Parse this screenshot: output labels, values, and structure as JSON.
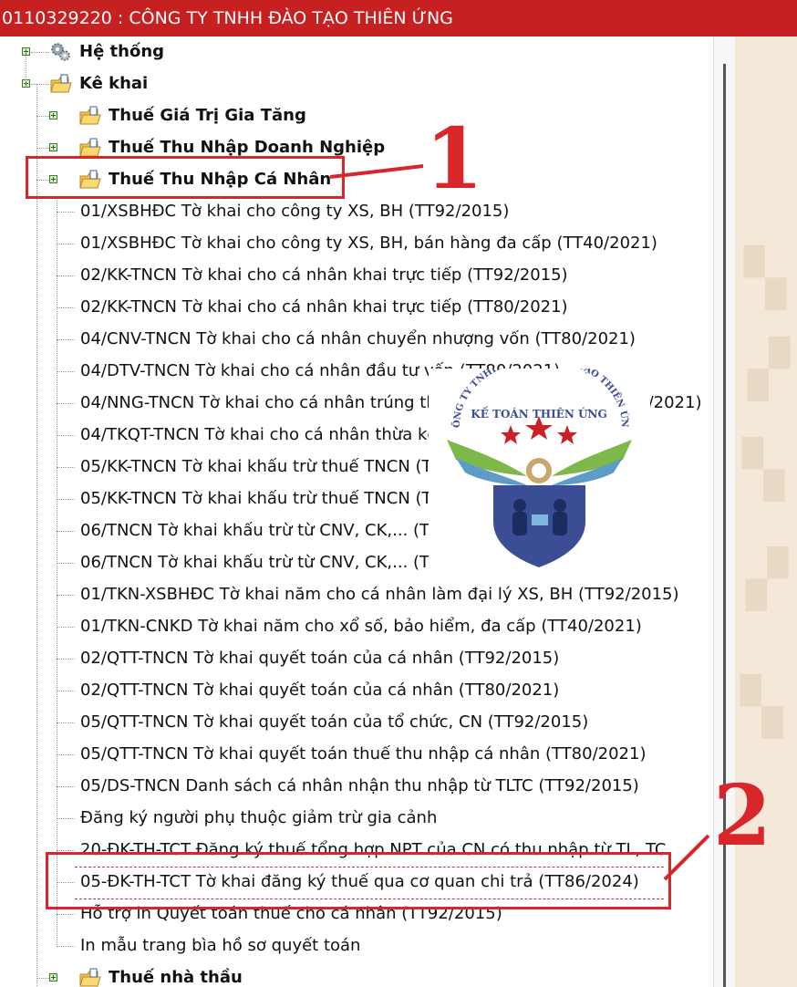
{
  "window": {
    "title": "0110329220 : CÔNG TY TNHH ĐÀO TẠO THIÊN ỨNG"
  },
  "tree": {
    "he_thong": "Hệ thống",
    "ke_khai": "Kê khai",
    "thue_gtgt": "Thuế Giá Trị Gia Tăng",
    "thue_tndn": "Thuế Thu Nhập Doanh Nghiệp",
    "thue_tncn": "Thuế Thu Nhập Cá Nhân",
    "tncn_items": [
      "01/XSBHĐC Tờ khai cho công ty XS, BH (TT92/2015)",
      "01/XSBHĐC Tờ khai cho công ty XS, BH, bán hàng đa cấp (TT40/2021)",
      "02/KK-TNCN Tờ khai cho cá nhân khai trực tiếp (TT92/2015)",
      "02/KK-TNCN Tờ khai cho cá nhân khai trực tiếp (TT80/2021)",
      "04/CNV-TNCN Tờ khai cho cá nhân chuyển nhượng vốn (TT80/2021)",
      "04/DTV-TNCN Tờ khai cho cá nhân đầu tư vốn (TT80/2021)",
      "04/NNG-TNCN Tờ khai cho cá nhân trúng thưởng từ nước ngoài (TT80/2021)",
      "04/TKQT-TNCN Tờ khai cho cá nhân thừa kế, quà tặng",
      "05/KK-TNCN Tờ khai khấu trừ thuế TNCN (TT92/2015)",
      "05/KK-TNCN Tờ khai khấu trừ thuế TNCN (TT80/2021)",
      "06/TNCN Tờ khai khấu trừ từ CNV, CK,... (TT92/2015)",
      "06/TNCN Tờ khai khấu trừ từ CNV, CK,... (TT80/2021)",
      "01/TKN-XSBHĐC Tờ khai năm cho cá nhân làm đại lý XS, BH (TT92/2015)",
      "01/TKN-CNKD Tờ khai năm cho xổ số, bảo hiểm, đa cấp (TT40/2021)",
      "02/QTT-TNCN Tờ khai quyết toán của cá nhân (TT92/2015)",
      "02/QTT-TNCN Tờ khai quyết toán của cá nhân (TT80/2021)",
      "05/QTT-TNCN Tờ khai quyết toán của tổ chức, CN (TT92/2015)",
      "05/QTT-TNCN Tờ khai quyết toán thuế thu nhập cá nhân (TT80/2021)",
      "05/DS-TNCN Danh sách cá nhân nhận thu nhập từ TLTC (TT92/2015)",
      "Đăng ký người phụ thuộc giảm trừ gia cảnh",
      "20-ĐK-TH-TCT Đăng ký thuế tổng hợp NPT của CN có thu nhập từ TL, TC",
      "05-ĐK-TH-TCT Tờ khai đăng ký thuế qua cơ quan chi trả (TT86/2024)",
      "Hỗ trợ in Quyết toán thuế cho cá nhân (TT92/2015)",
      "In mẫu trang bìa hồ sơ quyết toán"
    ],
    "thue_nha_thau": "Thuế nhà thầu"
  },
  "annotations": {
    "marker1": "1",
    "marker2": "2"
  },
  "logo": {
    "arc_text": "CÔNG TY TNHH DỊCH VỤ ĐÀO TẠO THIÊN ỨNG",
    "name": "KẾ TOÁN THIÊN ỨNG"
  },
  "colors": {
    "titlebar": "#c62020",
    "highlight": "#d8262a",
    "folder": "#f6c445",
    "shield": "#3b4e95"
  }
}
